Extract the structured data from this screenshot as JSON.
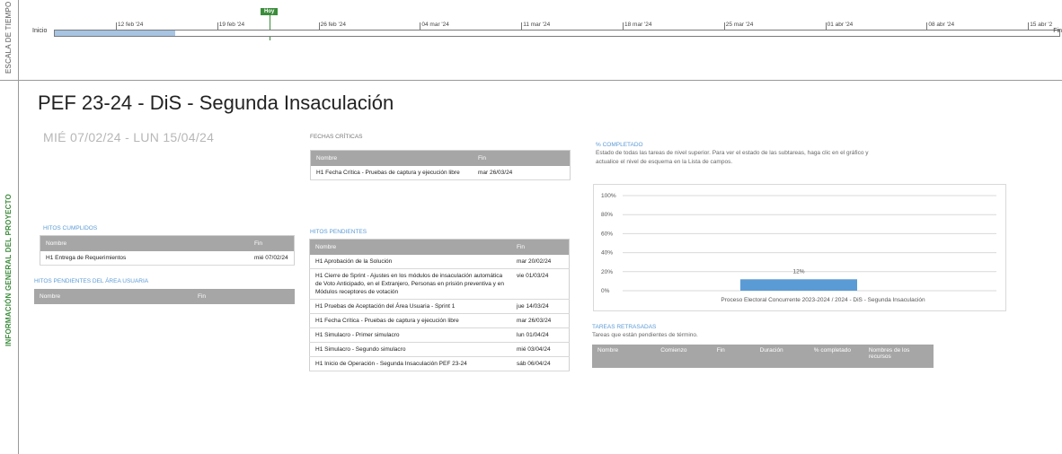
{
  "sidebar": {
    "timescale_label": "ESCALA DE TIEMPO",
    "project_info_label": "INFORMACIÓN GENERAL DEL PROYECTO"
  },
  "timeline": {
    "today_label": "Hoy",
    "start_label": "Inicio",
    "end_label": "Fin",
    "ticks": [
      "12 feb '24",
      "19 feb '24",
      "26 feb '24",
      "04 mar '24",
      "11 mar '24",
      "18 mar '24",
      "25 mar '24",
      "01 abr '24",
      "08 abr '24",
      "15 abr '2"
    ],
    "progress_fraction": 0.12
  },
  "project": {
    "title": "PEF 23-24 - DiS - Segunda Insaculación",
    "date_range": "MIÉ 07/02/24 -  LUN 15/04/24"
  },
  "critical_dates": {
    "label": "FECHAS CRÍTICAS",
    "columns": [
      "Nombre",
      "Fin"
    ],
    "rows": [
      [
        "H1 Fecha Crítica - Pruebas de captura y ejecución libre",
        "mar 26/03/24"
      ]
    ]
  },
  "milestones_done": {
    "label": "HITOS CUMPLIDOS",
    "columns": [
      "Nombre",
      "Fin"
    ],
    "rows": [
      [
        "H1 Entrega de Requerimientos",
        "mié 07/02/24"
      ]
    ]
  },
  "user_pending": {
    "label": "HITOS PENDIENTES DEL ÁREA USUARIA",
    "columns": [
      "Nombre",
      "Fin"
    ],
    "rows": []
  },
  "milestones_pending": {
    "label": "HITOS PENDIENTES",
    "columns": [
      "Nombre",
      "Fin"
    ],
    "rows": [
      [
        "H1 Aprobación de la Solución",
        "mar 20/02/24"
      ],
      [
        "H1 Cierre de Sprint - Ajustes en los módulos de insaculación automática de Voto Anticipado, en el Extranjero, Personas en prisión preventiva y en Módulos receptores de votación",
        "vie 01/03/24"
      ],
      [
        "H1 Pruebas de Aceptación del Área Usuaria - Sprint 1",
        "jue 14/03/24"
      ],
      [
        "H1 Fecha Crítica - Pruebas de captura y ejecución libre",
        "mar 26/03/24"
      ],
      [
        "H1 Simulacro - Primer simulacro",
        "lun 01/04/24"
      ],
      [
        "H1 Simulacro - Segundo simulacro",
        "mié 03/04/24"
      ],
      [
        "H1 Inicio de Operación - Segunda Insaculación PEF 23-24",
        "sáb 06/04/24"
      ]
    ]
  },
  "completion": {
    "label": "% COMPLETADO",
    "description": "Estado de todas las tareas de nivel superior. Para ver el estado de las subtareas, haga clic en el gráfico y actualice el nivel de esquema en la Lista de campos."
  },
  "late_tasks": {
    "label": "TAREAS RETRASADAS",
    "description": "Tareas que están pendientes de término.",
    "columns": [
      "Nombre",
      "Comienzo",
      "Fin",
      "Duración",
      "% completado",
      "Nombres de los recursos"
    ]
  },
  "chart_data": {
    "type": "bar",
    "categories": [
      "Proceso Electoral Concurrente 2023-2024 / 2024 - DiS - Segunda Insaculación"
    ],
    "values": [
      12
    ],
    "data_labels": [
      "12%"
    ],
    "ylim": [
      0,
      100
    ],
    "yticks": [
      "0%",
      "20%",
      "40%",
      "60%",
      "80%",
      "100%"
    ],
    "grid": true,
    "bar_color": "#5b9bd5"
  }
}
